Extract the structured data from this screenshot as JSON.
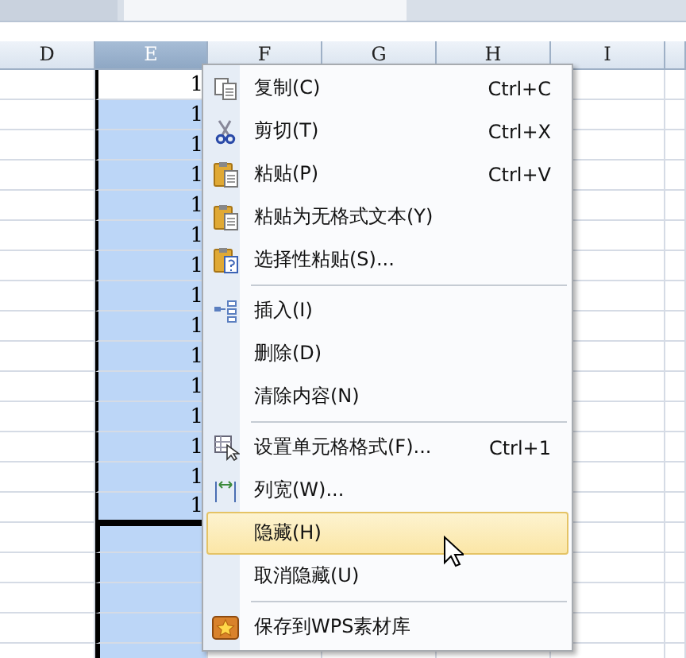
{
  "sheet": {
    "columns": [
      {
        "label": "D",
        "selected": false
      },
      {
        "label": "E",
        "selected": true
      },
      {
        "label": "F",
        "selected": false
      },
      {
        "label": "G",
        "selected": false
      },
      {
        "label": "H",
        "selected": false
      },
      {
        "label": "I",
        "selected": false
      }
    ],
    "column_e_values": [
      "1",
      "1",
      "1",
      "1",
      "1",
      "1",
      "1",
      "1",
      "1",
      "1",
      "1",
      "1",
      "1",
      "1",
      "1"
    ]
  },
  "context_menu": {
    "items": [
      {
        "kind": "item",
        "label": "复制(C)",
        "shortcut": "Ctrl+C",
        "selected": false
      },
      {
        "kind": "item",
        "label": "剪切(T)",
        "shortcut": "Ctrl+X",
        "selected": false
      },
      {
        "kind": "item",
        "label": "粘贴(P)",
        "shortcut": "Ctrl+V",
        "selected": false
      },
      {
        "kind": "item",
        "label": "粘贴为无格式文本(Y)",
        "selected": false
      },
      {
        "kind": "item",
        "label": "选择性粘贴(S)...",
        "selected": false
      },
      {
        "kind": "separator"
      },
      {
        "kind": "item",
        "label": "插入(I)",
        "selected": false
      },
      {
        "kind": "item",
        "label": "删除(D)",
        "selected": false
      },
      {
        "kind": "item",
        "label": "清除内容(N)",
        "selected": false
      },
      {
        "kind": "separator"
      },
      {
        "kind": "item",
        "label": "设置单元格格式(F)...",
        "shortcut": "Ctrl+1",
        "selected": false
      },
      {
        "kind": "item",
        "label": "列宽(W)...",
        "selected": false
      },
      {
        "kind": "item",
        "label": "隐藏(H)",
        "selected": true
      },
      {
        "kind": "item",
        "label": "取消隐藏(U)",
        "selected": false
      },
      {
        "kind": "separator"
      },
      {
        "kind": "item",
        "label": "保存到WPS素材库",
        "selected": false
      }
    ]
  }
}
